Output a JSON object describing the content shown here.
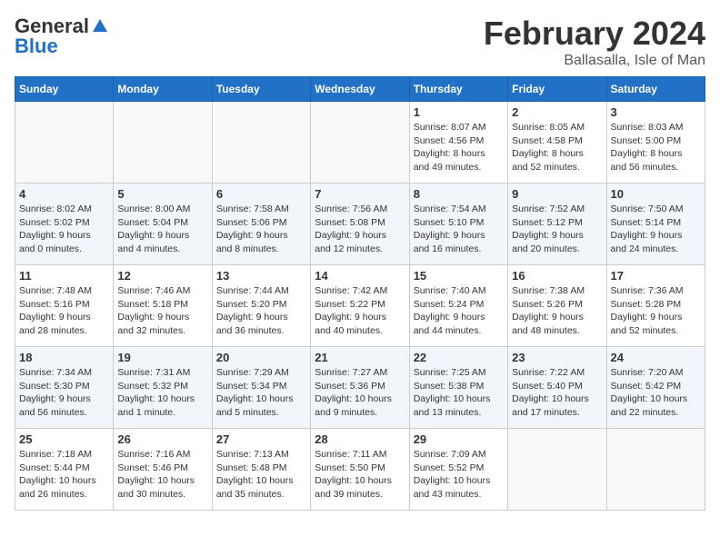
{
  "logo": {
    "general": "General",
    "blue": "Blue"
  },
  "title": {
    "month": "February 2024",
    "location": "Ballasalla, Isle of Man"
  },
  "weekdays": [
    "Sunday",
    "Monday",
    "Tuesday",
    "Wednesday",
    "Thursday",
    "Friday",
    "Saturday"
  ],
  "weeks": [
    [
      {
        "day": "",
        "info": ""
      },
      {
        "day": "",
        "info": ""
      },
      {
        "day": "",
        "info": ""
      },
      {
        "day": "",
        "info": ""
      },
      {
        "day": "1",
        "info": "Sunrise: 8:07 AM\nSunset: 4:56 PM\nDaylight: 8 hours\nand 49 minutes."
      },
      {
        "day": "2",
        "info": "Sunrise: 8:05 AM\nSunset: 4:58 PM\nDaylight: 8 hours\nand 52 minutes."
      },
      {
        "day": "3",
        "info": "Sunrise: 8:03 AM\nSunset: 5:00 PM\nDaylight: 8 hours\nand 56 minutes."
      }
    ],
    [
      {
        "day": "4",
        "info": "Sunrise: 8:02 AM\nSunset: 5:02 PM\nDaylight: 9 hours\nand 0 minutes."
      },
      {
        "day": "5",
        "info": "Sunrise: 8:00 AM\nSunset: 5:04 PM\nDaylight: 9 hours\nand 4 minutes."
      },
      {
        "day": "6",
        "info": "Sunrise: 7:58 AM\nSunset: 5:06 PM\nDaylight: 9 hours\nand 8 minutes."
      },
      {
        "day": "7",
        "info": "Sunrise: 7:56 AM\nSunset: 5:08 PM\nDaylight: 9 hours\nand 12 minutes."
      },
      {
        "day": "8",
        "info": "Sunrise: 7:54 AM\nSunset: 5:10 PM\nDaylight: 9 hours\nand 16 minutes."
      },
      {
        "day": "9",
        "info": "Sunrise: 7:52 AM\nSunset: 5:12 PM\nDaylight: 9 hours\nand 20 minutes."
      },
      {
        "day": "10",
        "info": "Sunrise: 7:50 AM\nSunset: 5:14 PM\nDaylight: 9 hours\nand 24 minutes."
      }
    ],
    [
      {
        "day": "11",
        "info": "Sunrise: 7:48 AM\nSunset: 5:16 PM\nDaylight: 9 hours\nand 28 minutes."
      },
      {
        "day": "12",
        "info": "Sunrise: 7:46 AM\nSunset: 5:18 PM\nDaylight: 9 hours\nand 32 minutes."
      },
      {
        "day": "13",
        "info": "Sunrise: 7:44 AM\nSunset: 5:20 PM\nDaylight: 9 hours\nand 36 minutes."
      },
      {
        "day": "14",
        "info": "Sunrise: 7:42 AM\nSunset: 5:22 PM\nDaylight: 9 hours\nand 40 minutes."
      },
      {
        "day": "15",
        "info": "Sunrise: 7:40 AM\nSunset: 5:24 PM\nDaylight: 9 hours\nand 44 minutes."
      },
      {
        "day": "16",
        "info": "Sunrise: 7:38 AM\nSunset: 5:26 PM\nDaylight: 9 hours\nand 48 minutes."
      },
      {
        "day": "17",
        "info": "Sunrise: 7:36 AM\nSunset: 5:28 PM\nDaylight: 9 hours\nand 52 minutes."
      }
    ],
    [
      {
        "day": "18",
        "info": "Sunrise: 7:34 AM\nSunset: 5:30 PM\nDaylight: 9 hours\nand 56 minutes."
      },
      {
        "day": "19",
        "info": "Sunrise: 7:31 AM\nSunset: 5:32 PM\nDaylight: 10 hours\nand 1 minute."
      },
      {
        "day": "20",
        "info": "Sunrise: 7:29 AM\nSunset: 5:34 PM\nDaylight: 10 hours\nand 5 minutes."
      },
      {
        "day": "21",
        "info": "Sunrise: 7:27 AM\nSunset: 5:36 PM\nDaylight: 10 hours\nand 9 minutes."
      },
      {
        "day": "22",
        "info": "Sunrise: 7:25 AM\nSunset: 5:38 PM\nDaylight: 10 hours\nand 13 minutes."
      },
      {
        "day": "23",
        "info": "Sunrise: 7:22 AM\nSunset: 5:40 PM\nDaylight: 10 hours\nand 17 minutes."
      },
      {
        "day": "24",
        "info": "Sunrise: 7:20 AM\nSunset: 5:42 PM\nDaylight: 10 hours\nand 22 minutes."
      }
    ],
    [
      {
        "day": "25",
        "info": "Sunrise: 7:18 AM\nSunset: 5:44 PM\nDaylight: 10 hours\nand 26 minutes."
      },
      {
        "day": "26",
        "info": "Sunrise: 7:16 AM\nSunset: 5:46 PM\nDaylight: 10 hours\nand 30 minutes."
      },
      {
        "day": "27",
        "info": "Sunrise: 7:13 AM\nSunset: 5:48 PM\nDaylight: 10 hours\nand 35 minutes."
      },
      {
        "day": "28",
        "info": "Sunrise: 7:11 AM\nSunset: 5:50 PM\nDaylight: 10 hours\nand 39 minutes."
      },
      {
        "day": "29",
        "info": "Sunrise: 7:09 AM\nSunset: 5:52 PM\nDaylight: 10 hours\nand 43 minutes."
      },
      {
        "day": "",
        "info": ""
      },
      {
        "day": "",
        "info": ""
      }
    ]
  ]
}
